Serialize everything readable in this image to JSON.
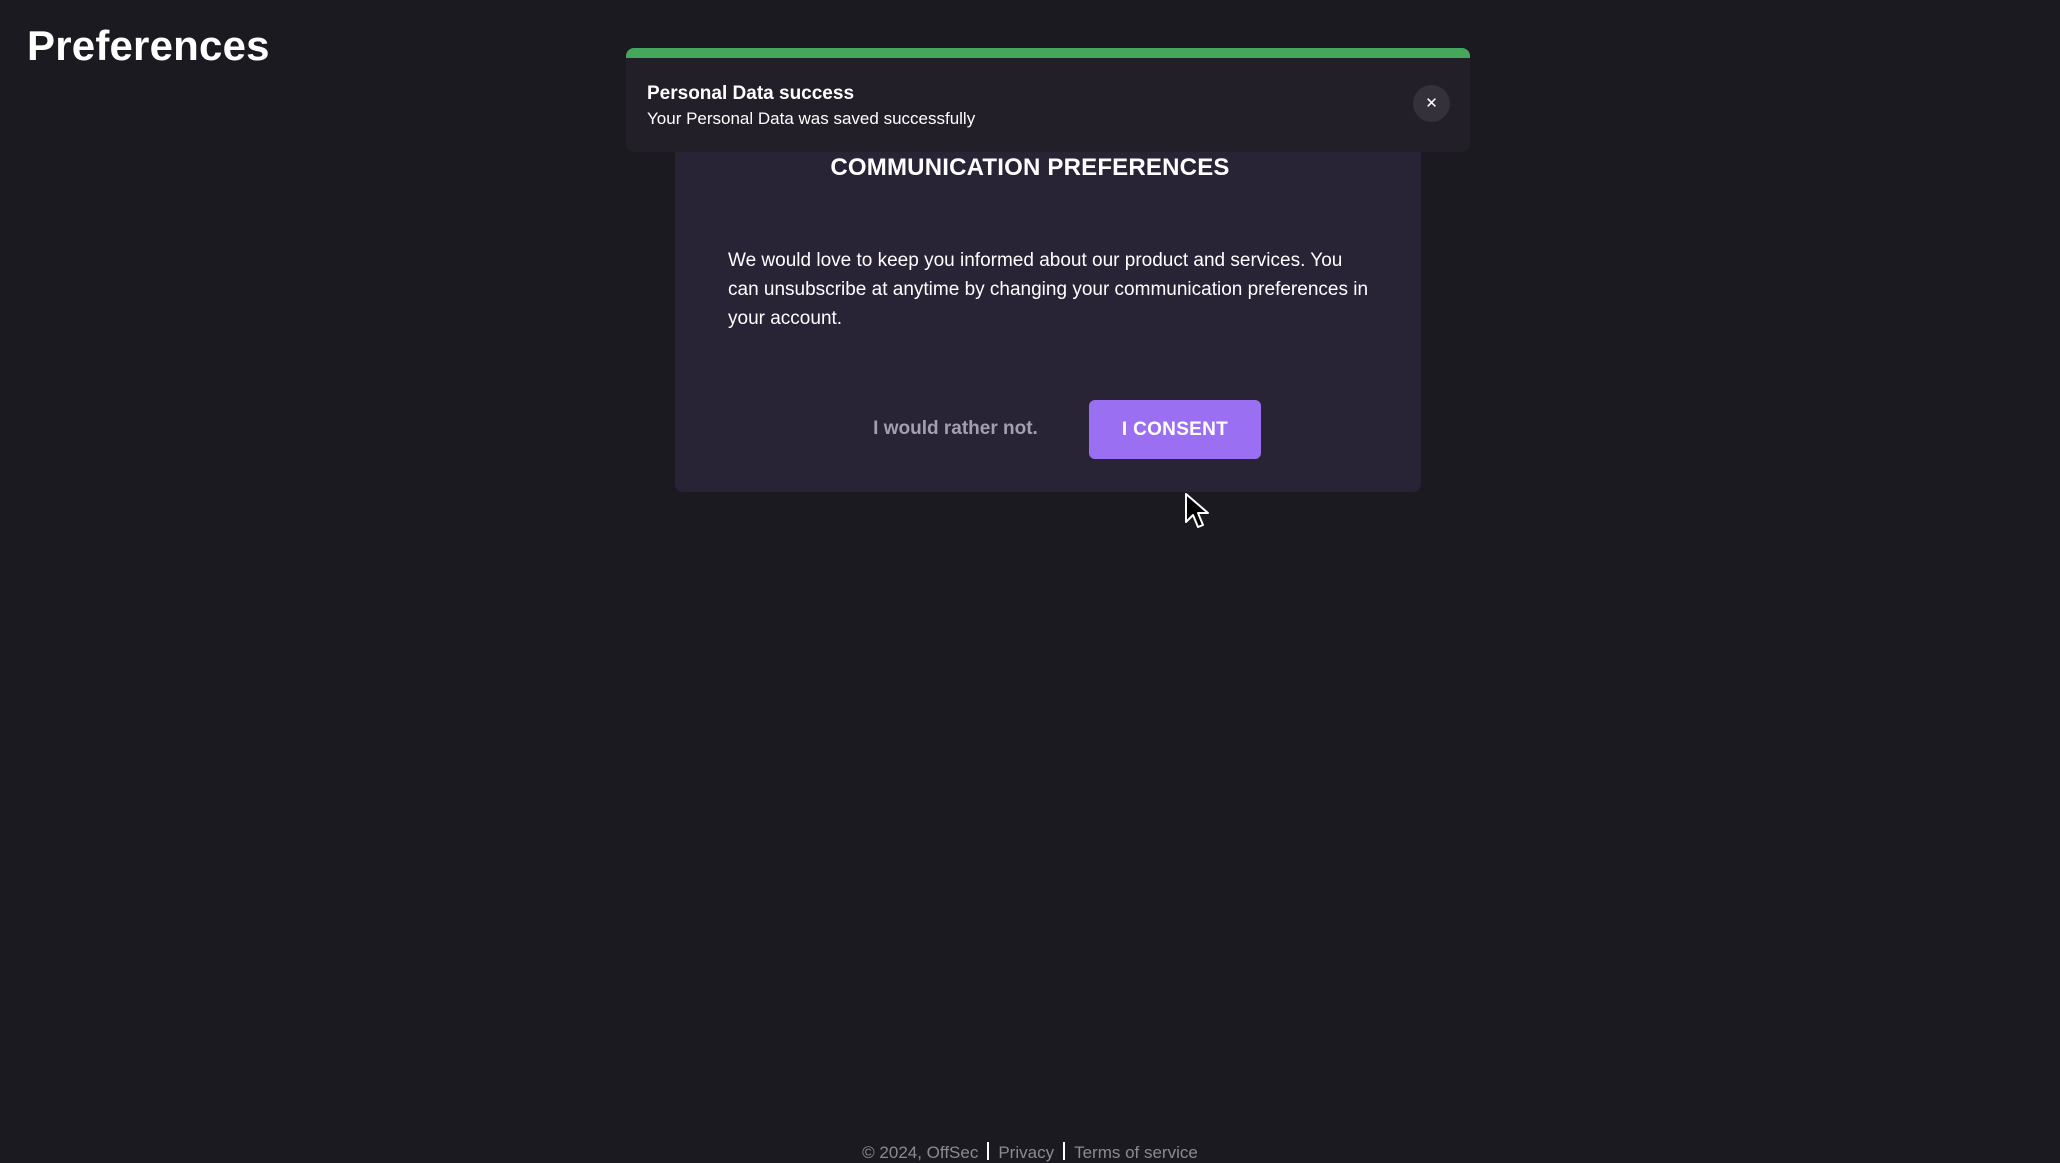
{
  "page": {
    "title": "Preferences"
  },
  "toast": {
    "title": "Personal Data success",
    "message": "Your Personal Data was saved successfully",
    "close_icon": "close-icon",
    "close_glyph": "✕",
    "accent_color": "#45a75b"
  },
  "consent_card": {
    "title": "COMMUNICATION PREFERENCES",
    "body": "We would love to keep you informed about our product and services. You can unsubscribe at anytime by changing your communication preferences in your account.",
    "decline_label": "I would rather not.",
    "consent_label": "I CONSENT",
    "consent_color": "#9b6ff2"
  },
  "footer": {
    "copyright": "© 2024, OffSec",
    "privacy_label": "Privacy",
    "terms_label": "Terms of service"
  },
  "cursor_icon": "mouse-pointer-icon"
}
